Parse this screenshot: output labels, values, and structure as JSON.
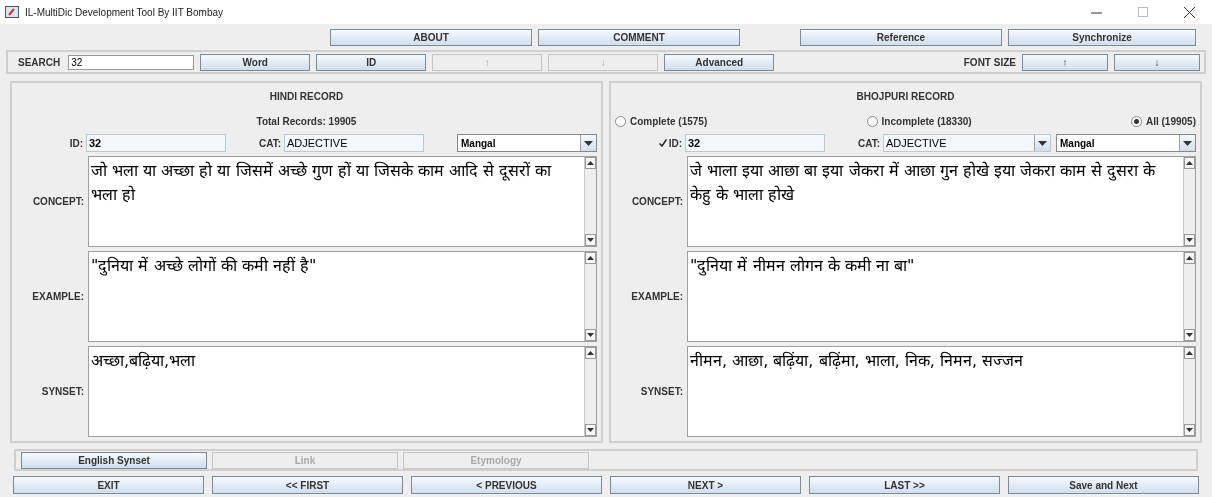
{
  "window": {
    "title": "IL-MultiDic Development Tool By IIT Bombay"
  },
  "top_buttons": [
    {
      "label": "ABOUT"
    },
    {
      "label": "COMMENT"
    },
    {
      "label": "Reference"
    },
    {
      "label": "Synchronize"
    }
  ],
  "search": {
    "label": "SEARCH",
    "value": "32",
    "buttons": [
      {
        "label": "Word",
        "disabled": false
      },
      {
        "label": "ID",
        "disabled": false
      },
      {
        "label": "↑",
        "disabled": true
      },
      {
        "label": "↓",
        "disabled": true
      },
      {
        "label": "Advanced",
        "disabled": false
      }
    ],
    "font_size": {
      "label": "FONT SIZE",
      "buttons": [
        "↑",
        "↓"
      ]
    }
  },
  "panels": [
    {
      "title": "HINDI RECORD",
      "subtitle": "Total Records: 19905",
      "id_label": "ID:",
      "id_checked": false,
      "id_value": "32",
      "cat_label": "CAT:",
      "cat_value": "ADJECTIVE",
      "cat_dropdown": false,
      "font": "Mangal",
      "fields": [
        {
          "label": "CONCEPT:",
          "text": "जो भला या अच्छा हो या जिसमें अच्छे गुण हों या जिसके काम आदि से दूसरों का भला हो"
        },
        {
          "label": "EXAMPLE:",
          "text": "\"दुनिया में अच्छे लोगों की कमी नहीं है\""
        },
        {
          "label": "SYNSET:",
          "text": "अच्छा,बढ़िया,भला"
        }
      ]
    },
    {
      "title": "BHOJPURI RECORD",
      "filters": [
        {
          "label": "Complete (1575)",
          "selected": false
        },
        {
          "label": "Incomplete (18330)",
          "selected": false
        },
        {
          "label": "All (19905)",
          "selected": true
        }
      ],
      "id_label": "ID:",
      "id_checked": true,
      "id_value": "32",
      "cat_label": "CAT:",
      "cat_value": "ADJECTIVE",
      "cat_dropdown": true,
      "font": "Mangal",
      "fields": [
        {
          "label": "CONCEPT:",
          "text": "जे भाला इया आछा बा इया जेकरा में आछा गुन होखे इया जेकरा काम से दुसरा के केहु के भाला होखे"
        },
        {
          "label": "EXAMPLE:",
          "text": "\"दुनिया में नीमन लोगन के कमी ना बा\""
        },
        {
          "label": "SYNSET:",
          "text": "नीमन, आछा, बढ़िंया, बढ़िंमा, भाला, निक, निमन, सज्जन"
        }
      ]
    }
  ],
  "bottom_tabs": [
    {
      "label": "English Synset",
      "disabled": false
    },
    {
      "label": "Link",
      "disabled": true
    },
    {
      "label": "Etymology",
      "disabled": true
    }
  ],
  "nav_buttons": [
    {
      "label": "EXIT"
    },
    {
      "label": "<< FIRST"
    },
    {
      "label": "< PREVIOUS"
    },
    {
      "label": "NEXT >"
    },
    {
      "label": "LAST >>"
    },
    {
      "label": "Save and Next"
    }
  ]
}
